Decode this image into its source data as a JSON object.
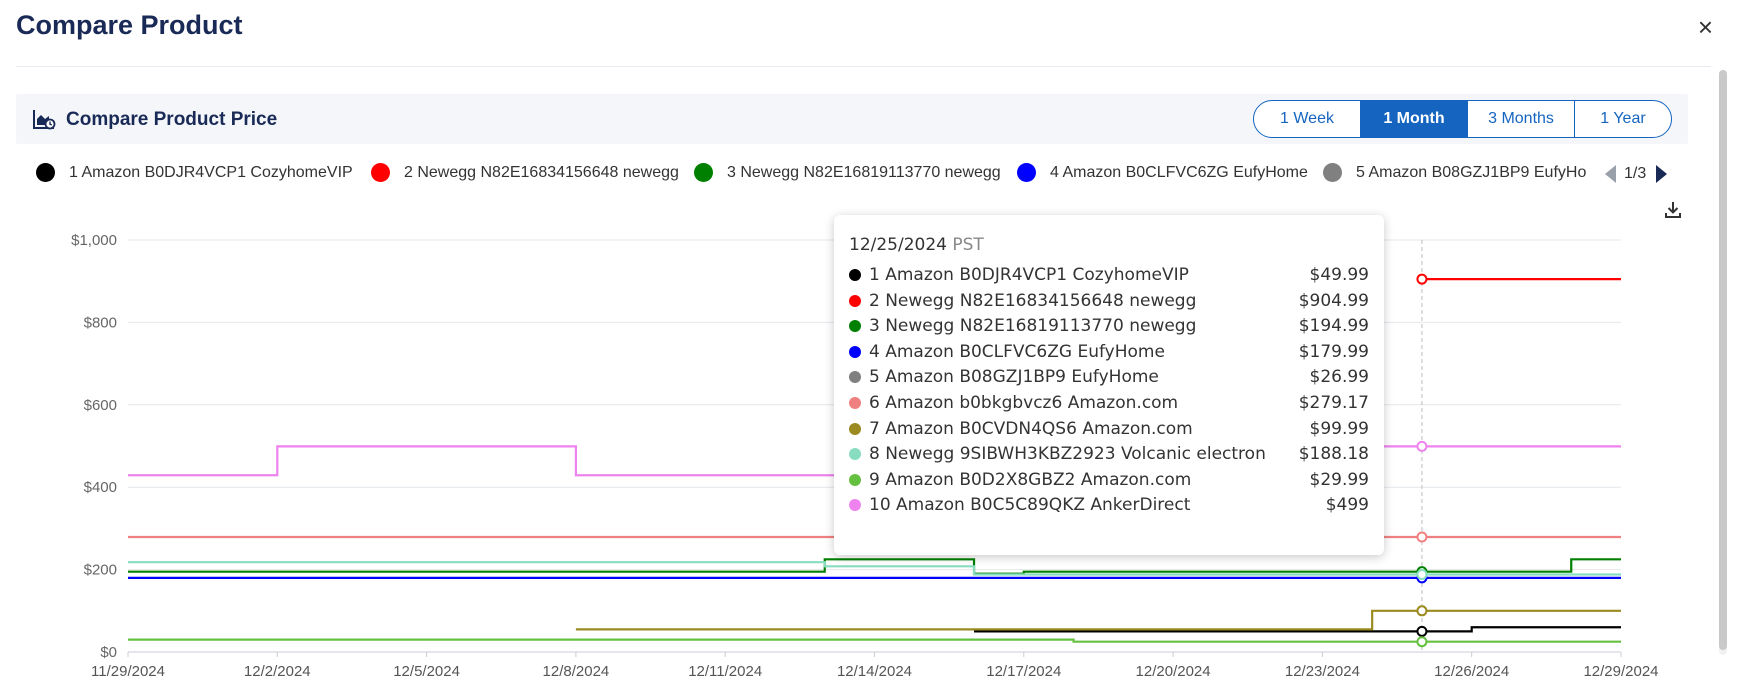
{
  "dialog": {
    "title": "Compare Product",
    "close_label": "×"
  },
  "card": {
    "title": "Compare Product Price",
    "ranges": [
      {
        "label": "1 Week",
        "active": false
      },
      {
        "label": "1 Month",
        "active": true
      },
      {
        "label": "3 Months",
        "active": false
      },
      {
        "label": "1 Year",
        "active": false
      }
    ]
  },
  "legend": {
    "items": [
      {
        "label": "1 Amazon B0DJR4VCP1 CozyhomeVIP",
        "color": "#000000"
      },
      {
        "label": "2 Newegg N82E16834156648 newegg",
        "color": "#ff0000"
      },
      {
        "label": "3 Newegg N82E16819113770 newegg",
        "color": "#008000"
      },
      {
        "label": "4 Amazon B0CLFVC6ZG EufyHome",
        "color": "#0000ff"
      },
      {
        "label": "5 Amazon B08GZJ1BP9 EufyHo",
        "color": "#808080"
      }
    ],
    "page": "1/3"
  },
  "tooltip": {
    "date": "12/25/2024",
    "tz": "PST",
    "rows": [
      {
        "name": "1 Amazon B0DJR4VCP1 CozyhomeVIP",
        "price": "$49.99",
        "color": "#000000"
      },
      {
        "name": "2 Newegg N82E16834156648 newegg",
        "price": "$904.99",
        "color": "#ff0000"
      },
      {
        "name": "3 Newegg N82E16819113770 newegg",
        "price": "$194.99",
        "color": "#008000"
      },
      {
        "name": "4 Amazon B0CLFVC6ZG EufyHome",
        "price": "$179.99",
        "color": "#0000ff"
      },
      {
        "name": "5 Amazon B08GZJ1BP9 EufyHome",
        "price": "$26.99",
        "color": "#808080"
      },
      {
        "name": "6 Amazon b0bkgbvcz6 Amazon.com",
        "price": "$279.17",
        "color": "#f08080"
      },
      {
        "name": "7 Amazon B0CVDN4QS6 Amazon.com",
        "price": "$99.99",
        "color": "#9a8a20"
      },
      {
        "name": "8 Newegg 9SIBWH3KBZ2923 Volcanic electron",
        "price": "$188.18",
        "color": "#88ddc0"
      },
      {
        "name": "9 Amazon B0D2X8GBZ2 Amazon.com",
        "price": "$29.99",
        "color": "#66c040"
      },
      {
        "name": "10 Amazon B0C5C89QKZ AnkerDirect",
        "price": "$499",
        "color": "#ee82ee"
      }
    ]
  },
  "chart_data": {
    "type": "line",
    "step": true,
    "x_ticks": [
      "11/29/2024",
      "12/2/2024",
      "12/5/2024",
      "12/8/2024",
      "12/11/2024",
      "12/14/2024",
      "12/17/2024",
      "12/20/2024",
      "12/23/2024",
      "12/26/2024",
      "12/29/2024"
    ],
    "y_ticks": [
      "$0",
      "$200",
      "$400",
      "$600",
      "$800",
      "$1,000"
    ],
    "x_range": [
      "11/29/2024",
      "12/29/2024"
    ],
    "ylim": [
      0,
      1000
    ],
    "hover_date": "12/25/2024",
    "series": [
      {
        "name": "1 Amazon B0DJR4VCP1 CozyhomeVIP",
        "color": "#000000",
        "points": [
          [
            "12/16/2024",
            49.99
          ],
          [
            "12/26/2024",
            59.99
          ],
          [
            "12/29/2024",
            59.99
          ]
        ]
      },
      {
        "name": "2 Newegg N82E16834156648 newegg",
        "color": "#ff0000",
        "points": [
          [
            "12/25/2024",
            904.99
          ],
          [
            "12/29/2024",
            904.99
          ]
        ]
      },
      {
        "name": "3 Newegg N82E16819113770 newegg",
        "color": "#008000",
        "points": [
          [
            "11/29/2024",
            194.99
          ],
          [
            "12/13/2024",
            224.99
          ],
          [
            "12/16/2024",
            189.99
          ],
          [
            "12/17/2024",
            194.99
          ],
          [
            "12/28/2024",
            224.99
          ],
          [
            "12/29/2024",
            224.99
          ]
        ]
      },
      {
        "name": "4 Amazon B0CLFVC6ZG EufyHome",
        "color": "#0000ff",
        "points": [
          [
            "11/29/2024",
            179.99
          ],
          [
            "12/29/2024",
            179.99
          ]
        ]
      },
      {
        "name": "6 Amazon b0bkgbvcz6 Amazon.com",
        "color": "#f08080",
        "points": [
          [
            "11/29/2024",
            279.17
          ],
          [
            "12/29/2024",
            279.17
          ]
        ]
      },
      {
        "name": "7 Amazon B0CVDN4QS6 Amazon.com",
        "color": "#9a8a20",
        "points": [
          [
            "12/8/2024",
            54.99
          ],
          [
            "12/24/2024",
            99.99
          ],
          [
            "12/29/2024",
            99.99
          ]
        ]
      },
      {
        "name": "8 Newegg 9SIBWH3KBZ2923 Volcanic electron",
        "color": "#88ddc0",
        "points": [
          [
            "11/29/2024",
            218
          ],
          [
            "12/13/2024",
            208
          ],
          [
            "12/16/2024",
            188.18
          ],
          [
            "12/29/2024",
            188.18
          ]
        ]
      },
      {
        "name": "9 Amazon B0D2X8GBZ2 Amazon.com",
        "color": "#66c040",
        "points": [
          [
            "11/29/2024",
            29.99
          ],
          [
            "12/18/2024",
            24.99
          ],
          [
            "12/29/2024",
            24.99
          ]
        ]
      },
      {
        "name": "10 Amazon B0C5C89QKZ AnkerDirect",
        "color": "#ee82ee",
        "points": [
          [
            "11/29/2024",
            429
          ],
          [
            "12/2/2024",
            499
          ],
          [
            "12/8/2024",
            429
          ],
          [
            "12/14/2024",
            499
          ],
          [
            "12/29/2024",
            499
          ]
        ]
      }
    ]
  }
}
